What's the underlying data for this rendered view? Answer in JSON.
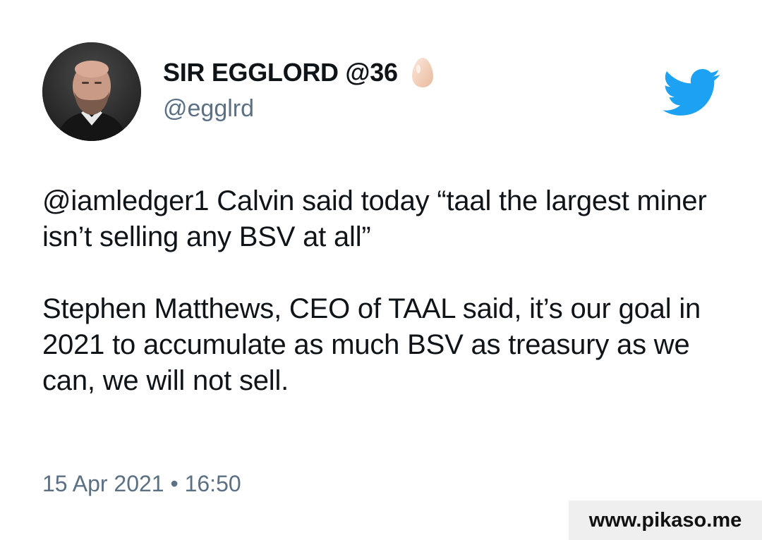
{
  "tweet": {
    "display_name": "SIR EGGLORD @36",
    "name_emoji": "egg-icon",
    "handle": "@egglrd",
    "paragraphs": [
      "@iamledger1 Calvin said today “taal the largest miner isn’t selling any BSV at all”",
      "Stephen Matthews, CEO of TAAL said, it’s our goal in 2021 to accumulate as much BSV as treasury as we can, we will not sell."
    ],
    "timestamp": "15 Apr 2021 • 16:50"
  },
  "brand_icon": "twitter-bird-icon",
  "watermark": "www.pikaso.me",
  "colors": {
    "text": "#0f1419",
    "secondary_text": "#5b7083",
    "twitter_blue": "#1da1f2",
    "watermark_bg": "#efefef"
  }
}
